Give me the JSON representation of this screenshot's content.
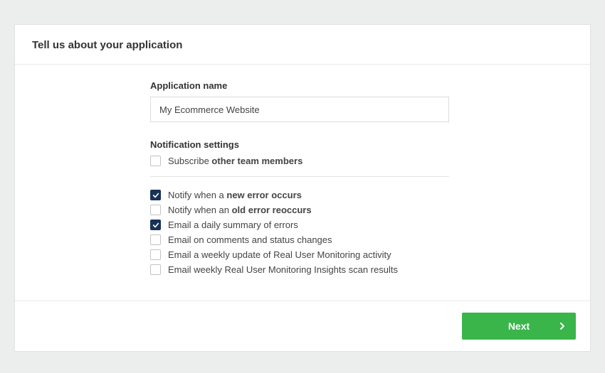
{
  "header": {
    "title": "Tell us about your application"
  },
  "form": {
    "app_name_label": "Application name",
    "app_name_value": "My Ecommerce Website",
    "notif_label": "Notification settings",
    "subscribe": {
      "pre": "Subscribe ",
      "bold": "other team members",
      "checked": false
    },
    "options": [
      {
        "pre": "Notify when a ",
        "bold": "new error occurs",
        "post": "",
        "checked": true
      },
      {
        "pre": "Notify when an ",
        "bold": "old error reoccurs",
        "post": "",
        "checked": false
      },
      {
        "pre": "Email a daily summary of errors",
        "bold": "",
        "post": "",
        "checked": true
      },
      {
        "pre": "Email on comments and status changes",
        "bold": "",
        "post": "",
        "checked": false
      },
      {
        "pre": "Email a weekly update of Real User Monitoring activity",
        "bold": "",
        "post": "",
        "checked": false
      },
      {
        "pre": "Email weekly Real User Monitoring Insights scan results",
        "bold": "",
        "post": "",
        "checked": false
      }
    ]
  },
  "footer": {
    "next_label": "Next"
  }
}
